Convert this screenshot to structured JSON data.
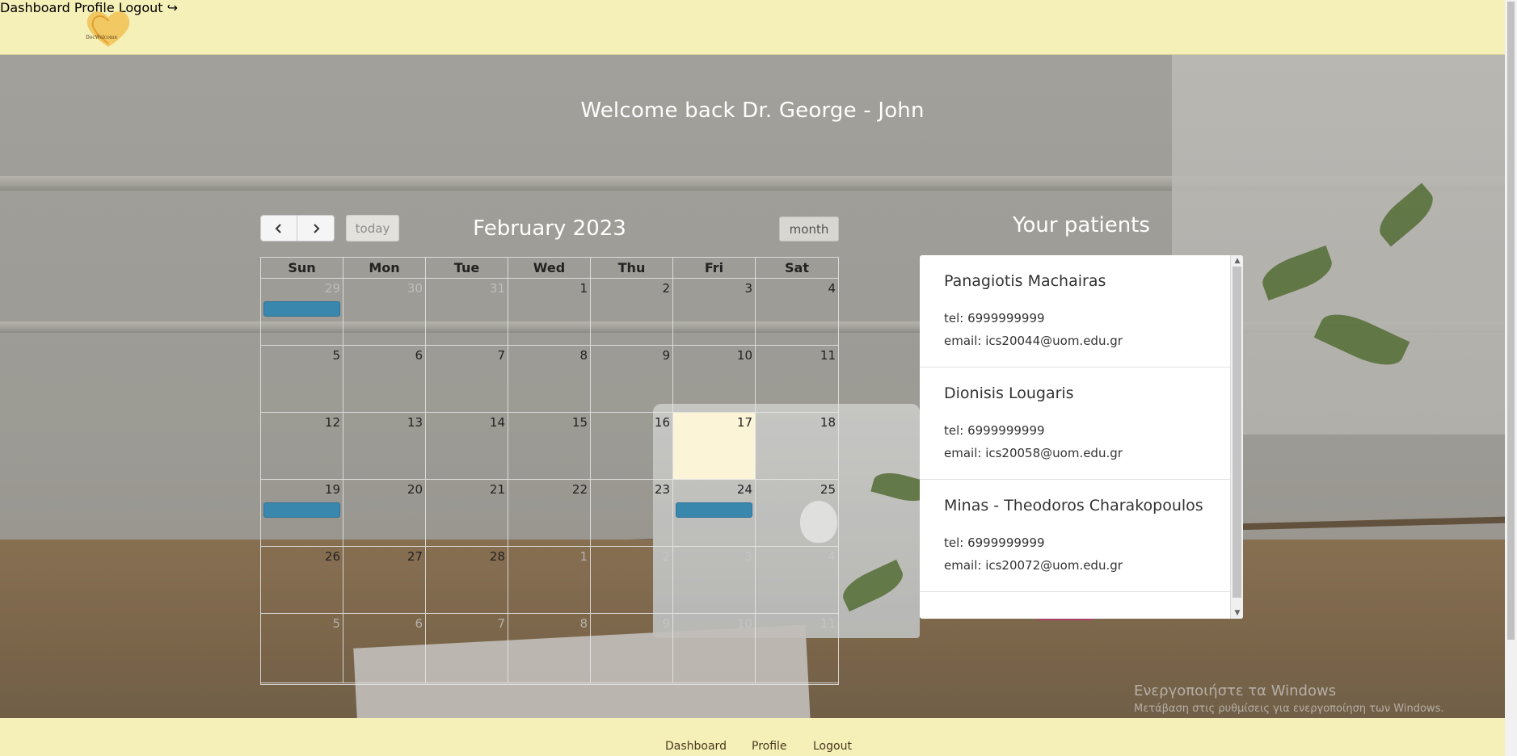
{
  "header": {
    "logo_text": "DocWelcome",
    "nav": {
      "dashboard": "Dashboard",
      "profile": "Profile",
      "logout": "Logout ↪"
    }
  },
  "welcome_text": "Welcome back Dr. George - John",
  "calendar": {
    "title": "February 2023",
    "today_label": "today",
    "month_label": "month",
    "weekdays": [
      "Sun",
      "Mon",
      "Tue",
      "Wed",
      "Thu",
      "Fri",
      "Sat"
    ],
    "days": [
      "29",
      "30",
      "31",
      "1",
      "2",
      "3",
      "4",
      "5",
      "6",
      "7",
      "8",
      "9",
      "10",
      "11",
      "12",
      "13",
      "14",
      "15",
      "16",
      "17",
      "18",
      "19",
      "20",
      "21",
      "22",
      "23",
      "24",
      "25",
      "26",
      "27",
      "28",
      "1",
      "2",
      "3",
      "4",
      "5",
      "6",
      "7",
      "8",
      "9",
      "10",
      "11"
    ],
    "other_month_indices": [
      0,
      1,
      2,
      31,
      32,
      33,
      34,
      35,
      36,
      37,
      38,
      39,
      40,
      41
    ],
    "today_index": 19,
    "event_indices": [
      0,
      21,
      26
    ],
    "event_color": "#3a87ad",
    "today_color": "#fff7d8"
  },
  "patients": {
    "title": "Your patients",
    "items": [
      {
        "name": "Panagiotis Machairas",
        "tel": "tel: 6999999999",
        "email": "email: ics20044@uom.edu.gr"
      },
      {
        "name": "Dionisis Lougaris",
        "tel": "tel: 6999999999",
        "email": "email: ics20058@uom.edu.gr"
      },
      {
        "name": "Minas - Theodoros Charakopoulos",
        "tel": "tel: 6999999999",
        "email": "email: ics20072@uom.edu.gr"
      }
    ]
  },
  "watermark": {
    "line1": "Ενεργοποιήστε τα Windows",
    "line2": "Μετάβαση στις ρυθμίσεις για ενεργοποίηση των Windows."
  },
  "footer": {
    "dashboard": "Dashboard",
    "profile": "Profile",
    "logout": "Logout"
  },
  "colors": {
    "header_bg": "#f5efb8",
    "nav_text": "#5a4020"
  }
}
